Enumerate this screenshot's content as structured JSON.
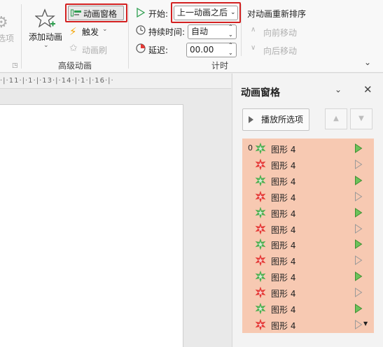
{
  "ribbon": {
    "options_partial": "选项",
    "add_animation": "添加动画",
    "animation_pane": "动画窗格",
    "trigger": "触发",
    "animation_painter": "动画刷",
    "advanced_group": "高级动画",
    "start_label": "开始:",
    "start_value": "上一动画之后",
    "duration_label": "持续时间:",
    "duration_value": "自动",
    "delay_label": "延迟:",
    "delay_value": "00.00",
    "reorder_title": "对动画重新排序",
    "move_earlier": "向前移动",
    "move_later": "向后移动",
    "timing_group": "计时"
  },
  "ruler": {
    "ticks": [
      "11",
      "13",
      "14",
      "16"
    ]
  },
  "pane": {
    "title": "动画窗格",
    "play_button": "播放所选项",
    "items": [
      {
        "num": "0",
        "label": "图形 4",
        "type": "entrance"
      },
      {
        "num": "",
        "label": "图形 4",
        "type": "exit"
      },
      {
        "num": "",
        "label": "图形 4",
        "type": "entrance"
      },
      {
        "num": "",
        "label": "图形 4",
        "type": "exit"
      },
      {
        "num": "",
        "label": "图形 4",
        "type": "entrance"
      },
      {
        "num": "",
        "label": "图形 4",
        "type": "exit"
      },
      {
        "num": "",
        "label": "图形 4",
        "type": "entrance"
      },
      {
        "num": "",
        "label": "图形 4",
        "type": "exit"
      },
      {
        "num": "",
        "label": "图形 4",
        "type": "entrance"
      },
      {
        "num": "",
        "label": "图形 4",
        "type": "exit"
      },
      {
        "num": "",
        "label": "图形 4",
        "type": "entrance"
      },
      {
        "num": "",
        "label": "图形 4",
        "type": "exit"
      }
    ]
  },
  "colors": {
    "highlight": "#d32020",
    "list_bg": "#f7c9b2",
    "entrance": "#4caf50",
    "exit": "#e53935"
  }
}
